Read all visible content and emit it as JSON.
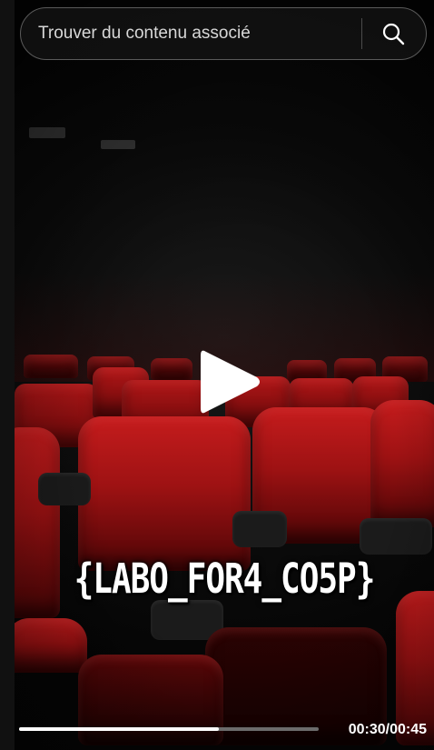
{
  "search": {
    "placeholder": "Trouver du contenu associé",
    "value": "",
    "icon": "search-icon"
  },
  "video": {
    "caption": "{LABO_FOR4_CO5P}",
    "play_icon": "play-icon",
    "current_time": "00:30",
    "duration": "00:45",
    "time_display": "00:30/00:45",
    "progress_fraction": 0.6667
  },
  "colors": {
    "seat_red": "#a51414",
    "progress_fill": "#ffffff",
    "progress_track": "#6c6c6c"
  }
}
